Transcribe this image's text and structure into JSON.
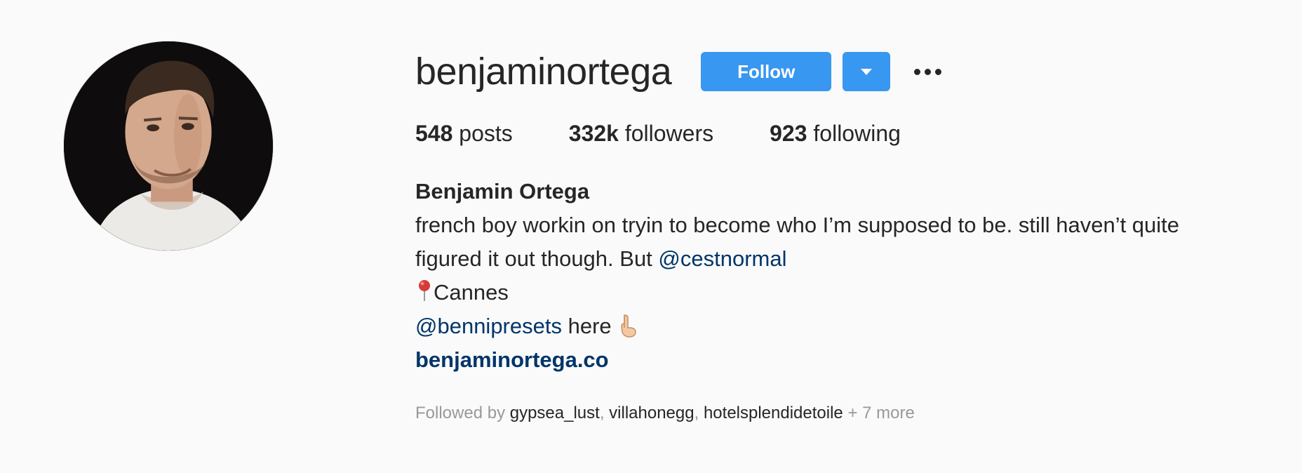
{
  "profile": {
    "username": "benjaminortega",
    "avatar_icon": "profile-photo",
    "actions": {
      "follow_label": "Follow",
      "dropdown_icon": "caret-down-icon",
      "more_icon": "more-options-icon",
      "accent_color": "#3897f0"
    },
    "stats": {
      "posts_count": "548",
      "posts_label": "posts",
      "followers_count": "332k",
      "followers_label": "followers",
      "following_count": "923",
      "following_label": "following"
    },
    "bio": {
      "full_name": "Benjamin Ortega",
      "line1": "french boy workin on tryin to become who I’m supposed to be. still haven’t quite",
      "line2_text": "figured it out though. But ",
      "line2_mention": "@cestnormal",
      "location": "Cannes",
      "location_icon": "pin-icon",
      "presets_mention": "@bennipresets",
      "presets_text": " here",
      "presets_icon": "pointing-down-hand-icon",
      "website": "benjaminortega.co",
      "mention_color": "#003569"
    },
    "followed_by": {
      "prefix": "Followed by ",
      "accounts": [
        "gypsea_lust",
        "villahonegg",
        "hotelsplendidetoile"
      ],
      "separator": ", ",
      "more": " + 7 more"
    }
  }
}
